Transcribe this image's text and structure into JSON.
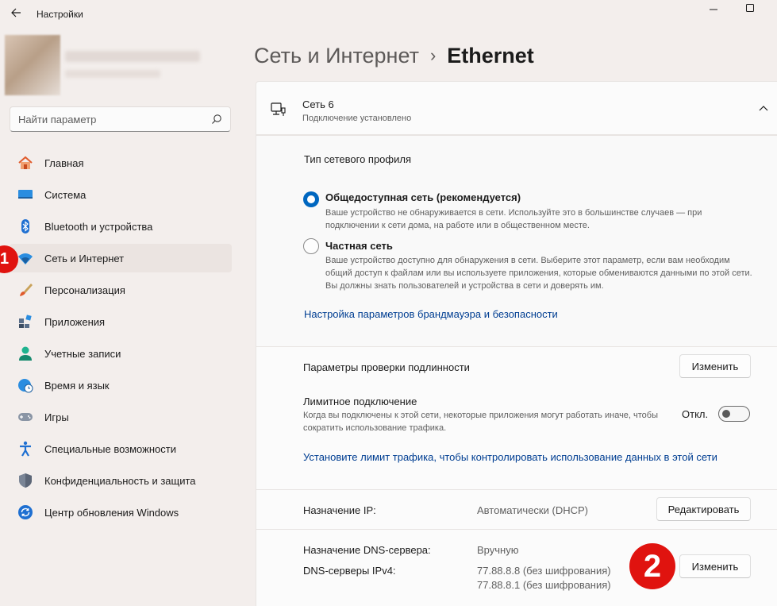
{
  "window": {
    "app_title": "Настройки"
  },
  "sidebar": {
    "search_placeholder": "Найти параметр",
    "items": [
      {
        "label": "Главная",
        "icon": "home-icon"
      },
      {
        "label": "Система",
        "icon": "system-icon"
      },
      {
        "label": "Bluetooth и устройства",
        "icon": "bluetooth-icon"
      },
      {
        "label": "Сеть и Интернет",
        "icon": "wifi-icon",
        "active": true
      },
      {
        "label": "Персонализация",
        "icon": "brush-icon"
      },
      {
        "label": "Приложения",
        "icon": "apps-icon"
      },
      {
        "label": "Учетные записи",
        "icon": "account-icon"
      },
      {
        "label": "Время и язык",
        "icon": "globe-clock-icon"
      },
      {
        "label": "Игры",
        "icon": "gamepad-icon"
      },
      {
        "label": "Специальные возможности",
        "icon": "accessibility-icon"
      },
      {
        "label": "Конфиденциальность и защита",
        "icon": "shield-icon"
      },
      {
        "label": "Центр обновления Windows",
        "icon": "update-icon"
      }
    ]
  },
  "annotations": {
    "badge1": "1",
    "badge2": "2"
  },
  "breadcrumb": {
    "parent": "Сеть и Интернет",
    "separator": "›",
    "current": "Ethernet"
  },
  "network": {
    "name": "Сеть 6",
    "status": "Подключение установлено"
  },
  "profile_type": {
    "title": "Тип сетевого профиля",
    "public_title": "Общедоступная сеть (рекомендуется)",
    "public_desc": "Ваше устройство не обнаруживается в сети. Используйте это в большинстве случаев — при подключении к сети дома, на работе или в общественном месте.",
    "private_title": "Частная сеть",
    "private_desc": "Ваше устройство доступно для обнаружения в сети. Выберите этот параметр, если вам необходим общий доступ к файлам или вы используете приложения, которые обмениваются данными по этой сети. Вы должны знать пользователей и устройства в сети и доверять им.",
    "firewall_link": "Настройка параметров брандмауэра и безопасности"
  },
  "auth": {
    "label": "Параметры проверки подлинности",
    "button": "Изменить"
  },
  "metered": {
    "label": "Лимитное подключение",
    "desc": "Когда вы подключены к этой сети, некоторые приложения могут работать иначе, чтобы сократить использование трафика.",
    "toggle_state": "Откл.",
    "toggle_on": false,
    "link": "Установите лимит трафика, чтобы контролировать использование данных в этой сети"
  },
  "ip": {
    "label": "Назначение IP:",
    "value": "Автоматически (DHCP)",
    "button": "Редактировать"
  },
  "dns": {
    "label": "Назначение DNS-сервера:",
    "value": "Вручную",
    "ipv4_label": "DNS-серверы IPv4:",
    "server1": "77.88.8.8 (без шифрования)",
    "server2": "77.88.8.1 (без шифрования)",
    "button": "Изменить"
  }
}
